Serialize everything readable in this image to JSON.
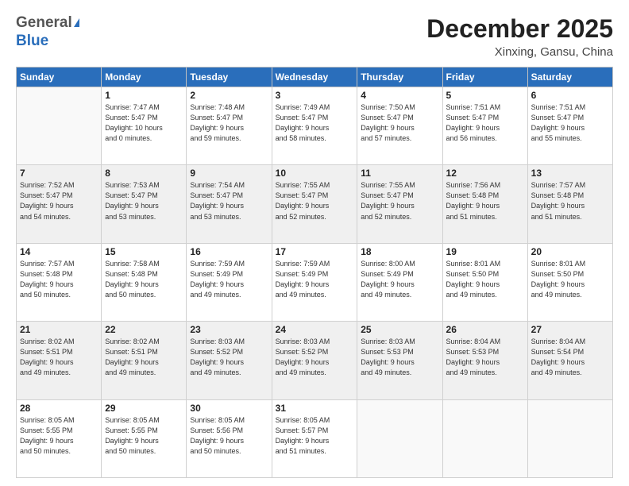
{
  "header": {
    "logo_general": "General",
    "logo_blue": "Blue",
    "month": "December 2025",
    "location": "Xinxing, Gansu, China"
  },
  "days_of_week": [
    "Sunday",
    "Monday",
    "Tuesday",
    "Wednesday",
    "Thursday",
    "Friday",
    "Saturday"
  ],
  "weeks": [
    [
      {
        "day": "",
        "text": ""
      },
      {
        "day": "1",
        "text": "Sunrise: 7:47 AM\nSunset: 5:47 PM\nDaylight: 10 hours\nand 0 minutes."
      },
      {
        "day": "2",
        "text": "Sunrise: 7:48 AM\nSunset: 5:47 PM\nDaylight: 9 hours\nand 59 minutes."
      },
      {
        "day": "3",
        "text": "Sunrise: 7:49 AM\nSunset: 5:47 PM\nDaylight: 9 hours\nand 58 minutes."
      },
      {
        "day": "4",
        "text": "Sunrise: 7:50 AM\nSunset: 5:47 PM\nDaylight: 9 hours\nand 57 minutes."
      },
      {
        "day": "5",
        "text": "Sunrise: 7:51 AM\nSunset: 5:47 PM\nDaylight: 9 hours\nand 56 minutes."
      },
      {
        "day": "6",
        "text": "Sunrise: 7:51 AM\nSunset: 5:47 PM\nDaylight: 9 hours\nand 55 minutes."
      }
    ],
    [
      {
        "day": "7",
        "text": "Sunrise: 7:52 AM\nSunset: 5:47 PM\nDaylight: 9 hours\nand 54 minutes."
      },
      {
        "day": "8",
        "text": "Sunrise: 7:53 AM\nSunset: 5:47 PM\nDaylight: 9 hours\nand 53 minutes."
      },
      {
        "day": "9",
        "text": "Sunrise: 7:54 AM\nSunset: 5:47 PM\nDaylight: 9 hours\nand 53 minutes."
      },
      {
        "day": "10",
        "text": "Sunrise: 7:55 AM\nSunset: 5:47 PM\nDaylight: 9 hours\nand 52 minutes."
      },
      {
        "day": "11",
        "text": "Sunrise: 7:55 AM\nSunset: 5:47 PM\nDaylight: 9 hours\nand 52 minutes."
      },
      {
        "day": "12",
        "text": "Sunrise: 7:56 AM\nSunset: 5:48 PM\nDaylight: 9 hours\nand 51 minutes."
      },
      {
        "day": "13",
        "text": "Sunrise: 7:57 AM\nSunset: 5:48 PM\nDaylight: 9 hours\nand 51 minutes."
      }
    ],
    [
      {
        "day": "14",
        "text": "Sunrise: 7:57 AM\nSunset: 5:48 PM\nDaylight: 9 hours\nand 50 minutes."
      },
      {
        "day": "15",
        "text": "Sunrise: 7:58 AM\nSunset: 5:48 PM\nDaylight: 9 hours\nand 50 minutes."
      },
      {
        "day": "16",
        "text": "Sunrise: 7:59 AM\nSunset: 5:49 PM\nDaylight: 9 hours\nand 49 minutes."
      },
      {
        "day": "17",
        "text": "Sunrise: 7:59 AM\nSunset: 5:49 PM\nDaylight: 9 hours\nand 49 minutes."
      },
      {
        "day": "18",
        "text": "Sunrise: 8:00 AM\nSunset: 5:49 PM\nDaylight: 9 hours\nand 49 minutes."
      },
      {
        "day": "19",
        "text": "Sunrise: 8:01 AM\nSunset: 5:50 PM\nDaylight: 9 hours\nand 49 minutes."
      },
      {
        "day": "20",
        "text": "Sunrise: 8:01 AM\nSunset: 5:50 PM\nDaylight: 9 hours\nand 49 minutes."
      }
    ],
    [
      {
        "day": "21",
        "text": "Sunrise: 8:02 AM\nSunset: 5:51 PM\nDaylight: 9 hours\nand 49 minutes."
      },
      {
        "day": "22",
        "text": "Sunrise: 8:02 AM\nSunset: 5:51 PM\nDaylight: 9 hours\nand 49 minutes."
      },
      {
        "day": "23",
        "text": "Sunrise: 8:03 AM\nSunset: 5:52 PM\nDaylight: 9 hours\nand 49 minutes."
      },
      {
        "day": "24",
        "text": "Sunrise: 8:03 AM\nSunset: 5:52 PM\nDaylight: 9 hours\nand 49 minutes."
      },
      {
        "day": "25",
        "text": "Sunrise: 8:03 AM\nSunset: 5:53 PM\nDaylight: 9 hours\nand 49 minutes."
      },
      {
        "day": "26",
        "text": "Sunrise: 8:04 AM\nSunset: 5:53 PM\nDaylight: 9 hours\nand 49 minutes."
      },
      {
        "day": "27",
        "text": "Sunrise: 8:04 AM\nSunset: 5:54 PM\nDaylight: 9 hours\nand 49 minutes."
      }
    ],
    [
      {
        "day": "28",
        "text": "Sunrise: 8:05 AM\nSunset: 5:55 PM\nDaylight: 9 hours\nand 50 minutes."
      },
      {
        "day": "29",
        "text": "Sunrise: 8:05 AM\nSunset: 5:55 PM\nDaylight: 9 hours\nand 50 minutes."
      },
      {
        "day": "30",
        "text": "Sunrise: 8:05 AM\nSunset: 5:56 PM\nDaylight: 9 hours\nand 50 minutes."
      },
      {
        "day": "31",
        "text": "Sunrise: 8:05 AM\nSunset: 5:57 PM\nDaylight: 9 hours\nand 51 minutes."
      },
      {
        "day": "",
        "text": ""
      },
      {
        "day": "",
        "text": ""
      },
      {
        "day": "",
        "text": ""
      }
    ]
  ]
}
